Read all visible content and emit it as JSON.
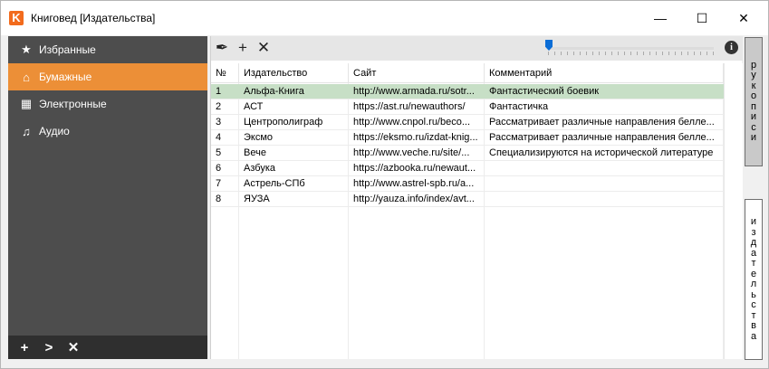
{
  "window": {
    "title": "Книговед [Издательства]",
    "app_icon_letter": "K",
    "min_glyph": "—",
    "max_glyph": "☐",
    "close_glyph": "✕"
  },
  "sidebar": {
    "items": [
      {
        "label": "Избранные",
        "icon": "star-icon",
        "glyph": "★"
      },
      {
        "label": "Бумажные",
        "icon": "house-icon",
        "glyph": "⌂"
      },
      {
        "label": "Электронные",
        "icon": "tiles-icon",
        "glyph": "▦"
      },
      {
        "label": "Аудио",
        "icon": "headphones-icon",
        "glyph": "♫"
      }
    ],
    "active_index": 1,
    "bottom": {
      "add": "+",
      "next": ">",
      "delete": "✕"
    }
  },
  "toolbar": {
    "edit_glyph": "✒",
    "add_glyph": "+",
    "delete_glyph": "✕",
    "info_glyph": "i",
    "slider_level": 0
  },
  "grid": {
    "columns": [
      "№",
      "Издательство",
      "Сайт",
      "Комментарий"
    ],
    "rows": [
      {
        "n": "1",
        "name": "Альфа-Книга",
        "site": "http://www.armada.ru/sotr...",
        "comment": "Фантастический боевик"
      },
      {
        "n": "2",
        "name": "АСТ",
        "site": "https://ast.ru/newauthors/",
        "comment": "Фантастичка"
      },
      {
        "n": "3",
        "name": "Центрополиграф",
        "site": "http://www.cnpol.ru/beco...",
        "comment": "Рассматривает различные направления белле..."
      },
      {
        "n": "4",
        "name": "Эксмо",
        "site": "https://eksmo.ru/izdat-knig...",
        "comment": "Рассматривает различные направления белле..."
      },
      {
        "n": "5",
        "name": "Вече",
        "site": "http://www.veche.ru/site/...",
        "comment": "Специализируются на исторической литературе"
      },
      {
        "n": "6",
        "name": "Азбука",
        "site": "https://azbooka.ru/newaut...",
        "comment": ""
      },
      {
        "n": "7",
        "name": "Астрель-СПб",
        "site": "http://www.astrel-spb.ru/a...",
        "comment": ""
      },
      {
        "n": "8",
        "name": "ЯУЗА",
        "site": "http://yauza.info/index/avt...",
        "comment": ""
      }
    ],
    "selected_row": 0
  },
  "right_tabs": {
    "manuscripts": "рукописи",
    "publishers": "издательства"
  },
  "colors": {
    "accent": "#ec8f37",
    "sidebar_bg": "#4d4d4d",
    "selected_row": "#c7dfc6"
  }
}
